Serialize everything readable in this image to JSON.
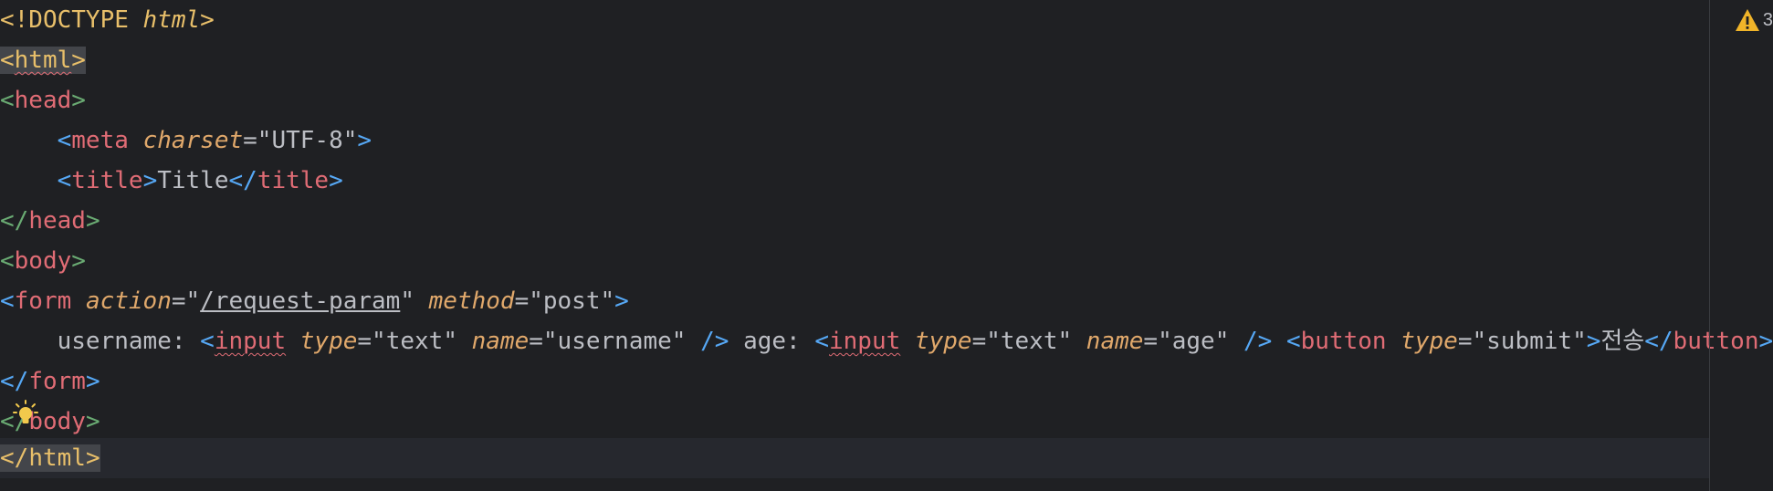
{
  "editor": {
    "warning_count": "3",
    "lines": [
      {
        "doctype_open": "<!DOCTYPE ",
        "doctype_kw": "html",
        "doctype_close": ">"
      },
      {
        "open": "<",
        "tag": "html",
        "close": ">"
      },
      {
        "open": "<",
        "tag": "head",
        "close": ">"
      },
      {
        "indent": "    ",
        "open": "<",
        "tag": "meta",
        "sp": " ",
        "attr": "charset",
        "eq": "=",
        "val": "\"UTF-8\"",
        "close": ">"
      },
      {
        "indent": "    ",
        "open": "<",
        "tag": "title",
        "close": ">",
        "text": "Title",
        "end_open": "</",
        "end_tag": "title",
        "end_close": ">"
      },
      {
        "open": "</",
        "tag": "head",
        "close": ">"
      },
      {
        "open": "<",
        "tag": "body",
        "close": ">"
      },
      {
        "open": "<",
        "tag": "form",
        "sp1": " ",
        "attr1": "action",
        "eq1": "=",
        "q1": "\"",
        "val1": "/request-param",
        "q2": "\"",
        "sp2": " ",
        "attr2": "method",
        "eq2": "=",
        "val2": "\"post\"",
        "close": ">"
      },
      {
        "indent": "    ",
        "label1": "username: ",
        "in1_open": "<",
        "in1_tag": "input",
        "in1_sp1": " ",
        "in1_attr1": "type",
        "in1_eq1": "=",
        "in1_val1": "\"text\"",
        "in1_sp2": " ",
        "in1_attr2": "name",
        "in1_eq2": "=",
        "in1_val2": "\"username\"",
        "in1_close": " />",
        "label2": " age: ",
        "in2_open": "<",
        "in2_tag": "input",
        "in2_sp1": " ",
        "in2_attr1": "type",
        "in2_eq1": "=",
        "in2_val1": "\"text\"",
        "in2_sp2": " ",
        "in2_attr2": "name",
        "in2_eq2": "=",
        "in2_val2": "\"age\"",
        "in2_close": " />",
        "sp3": " ",
        "btn_open": "<",
        "btn_tag": "button",
        "btn_sp": " ",
        "btn_attr": "type",
        "btn_eq": "=",
        "btn_val": "\"submit\"",
        "btn_close": ">",
        "btn_text": "전송",
        "btn_end_open": "</",
        "btn_end_tag": "button",
        "btn_end_close": ">"
      },
      {
        "open": "</",
        "tag": "form",
        "close": ">"
      },
      {
        "open": "</",
        "tag": "body",
        "close": ">"
      },
      {
        "open": "</",
        "tag": "html",
        "close": ">"
      }
    ]
  }
}
